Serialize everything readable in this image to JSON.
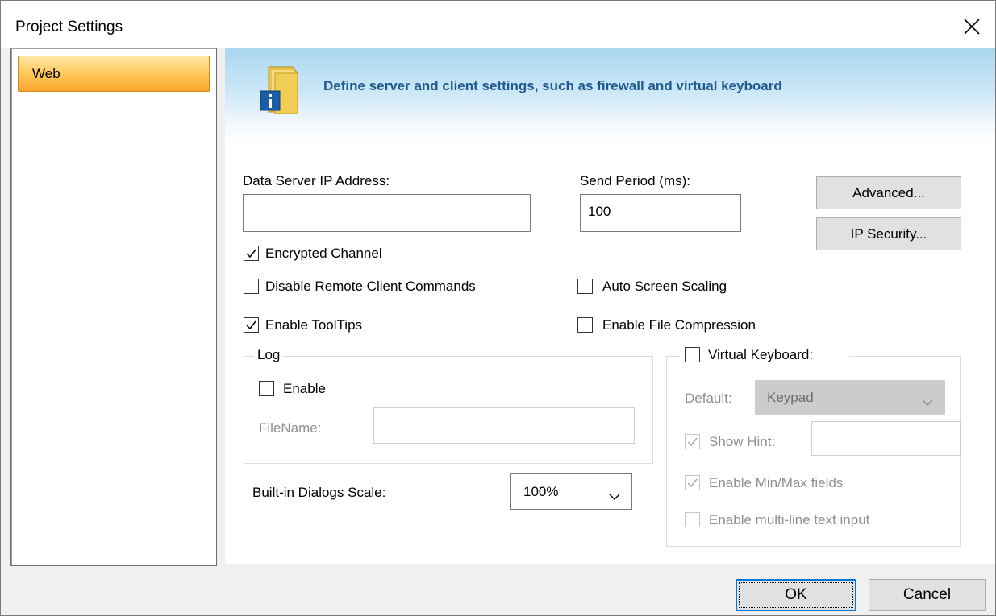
{
  "window": {
    "title": "Project Settings"
  },
  "sidebar": {
    "items": [
      {
        "label": "Web"
      }
    ]
  },
  "banner": {
    "text": "Define server and  client settings, such as firewall and virtual keyboard"
  },
  "data_server": {
    "label": "Data Server IP Address:",
    "value": ""
  },
  "send_period": {
    "label": "Send Period (ms):",
    "value": "100"
  },
  "buttons": {
    "advanced": "Advanced...",
    "ip_security": "IP Security...",
    "ok": "OK",
    "cancel": "Cancel"
  },
  "checkboxes": {
    "encrypted_channel": {
      "label": "Encrypted Channel",
      "checked": true
    },
    "disable_remote": {
      "label": "Disable Remote Client Commands",
      "checked": false
    },
    "enable_tooltips": {
      "label": "Enable ToolTips",
      "checked": true
    },
    "auto_screen_scaling": {
      "label": "Auto Screen Scaling",
      "checked": false
    },
    "enable_file_compression": {
      "label": "Enable File Compression",
      "checked": false
    }
  },
  "log": {
    "title": "Log",
    "enable_label": "Enable",
    "enable_checked": false,
    "filename_label": "FileName:",
    "filename_value": ""
  },
  "dialog_scale": {
    "label": "Built-in Dialogs Scale:",
    "value": "100%"
  },
  "virtual_keyboard": {
    "label": "Virtual Keyboard:",
    "checked": false,
    "default_label": "Default:",
    "default_value": "Keypad",
    "show_hint_label": "Show Hint:",
    "show_hint_checked": true,
    "show_hint_value": "",
    "min_max_label": "Enable Min/Max fields",
    "min_max_checked": true,
    "multiline_label": "Enable multi-line text input",
    "multiline_checked": false
  },
  "colors": {
    "accent": "#0078d7",
    "banner_text": "#1f5a8e",
    "selected_item": "#ffc85c"
  }
}
